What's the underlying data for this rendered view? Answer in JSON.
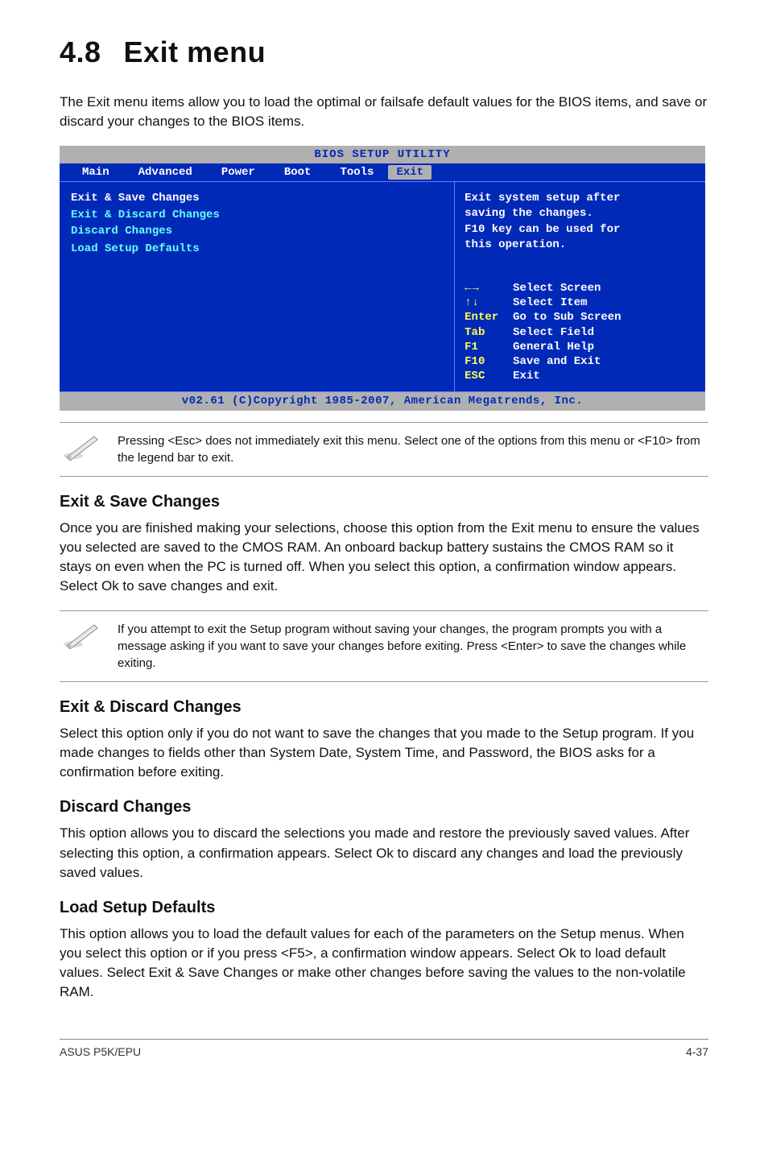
{
  "heading": {
    "num": "4.8",
    "title": "Exit menu"
  },
  "intro": "The Exit menu items allow you to load the optimal or failsafe default values for the BIOS items, and save or discard your changes to the BIOS items.",
  "bios": {
    "title": "BIOS SETUP UTILITY",
    "tabs": [
      "Main",
      "Advanced",
      "Power",
      "Boot",
      "Tools",
      "Exit"
    ],
    "active_tab": "Exit",
    "menu_items": [
      {
        "label": "Exit & Save Changes",
        "highlight": true
      },
      {
        "label": "Exit & Discard Changes",
        "highlight": false
      },
      {
        "label": "Discard Changes",
        "highlight": false
      },
      {
        "label": "",
        "highlight": false
      },
      {
        "label": "Load Setup Defaults",
        "highlight": false
      }
    ],
    "help": [
      "Exit system setup after",
      "saving the changes.",
      "",
      "F10 key can be used for",
      "this operation."
    ],
    "nav": [
      {
        "key": "←→",
        "label": "Select Screen"
      },
      {
        "key": "↑↓",
        "label": "Select Item"
      },
      {
        "key": "Enter",
        "label": "Go to Sub Screen"
      },
      {
        "key": "Tab",
        "label": "Select Field"
      },
      {
        "key": "F1",
        "label": "General Help"
      },
      {
        "key": "F10",
        "label": "Save and Exit"
      },
      {
        "key": "ESC",
        "label": "Exit"
      }
    ],
    "footer": "v02.61 (C)Copyright 1985-2007, American Megatrends, Inc."
  },
  "note1": "Pressing <Esc> does not immediately exit this menu. Select one of the options from this menu or <F10> from the legend bar to exit.",
  "sections": {
    "save": {
      "title": "Exit & Save Changes",
      "body": "Once you are finished making your selections, choose this option from the Exit menu to ensure the values you selected are saved to the CMOS RAM. An onboard backup battery sustains the CMOS RAM so it stays on even when the PC is turned off. When you select this option, a confirmation window appears. Select Ok to save changes and exit."
    },
    "note2": "If you attempt to exit the Setup program without saving your changes, the program prompts you with a message asking if you want to save your changes before exiting. Press <Enter> to save the changes while exiting.",
    "discardexit": {
      "title": "Exit & Discard Changes",
      "body": "Select this option only if you do not want to save the changes that you  made to the Setup program. If you made changes to fields other than System Date, System Time, and Password, the BIOS asks for a confirmation before exiting."
    },
    "discard": {
      "title": "Discard Changes",
      "body": "This option allows you to discard the selections you made and restore the previously saved values. After selecting this option, a confirmation appears. Select Ok to discard any changes and load the previously saved values."
    },
    "defaults": {
      "title": "Load Setup Defaults",
      "body": "This option allows you to load the default values for each of the parameters on the Setup menus. When you select this option or if you press <F5>, a confirmation window appears. Select Ok to load default values. Select Exit & Save Changes or make other changes before saving the values to the non-volatile RAM."
    }
  },
  "footer": {
    "left": "ASUS P5K/EPU",
    "right": "4-37"
  }
}
